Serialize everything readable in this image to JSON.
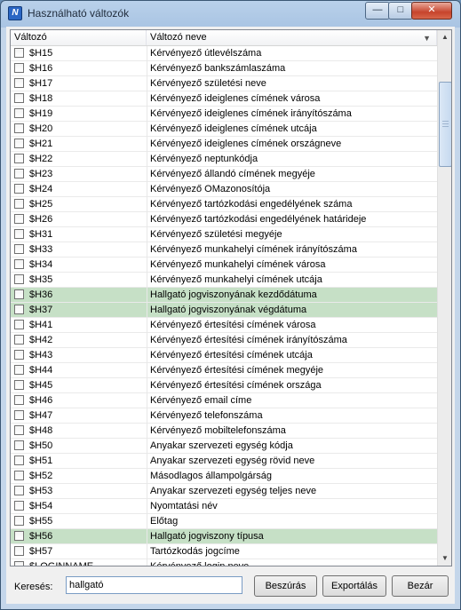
{
  "window": {
    "title": "Használható változók",
    "app_icon": "N"
  },
  "columns": {
    "variable": "Változó",
    "name": "Változó neve"
  },
  "rows": [
    {
      "var": "$H15",
      "name": "Kérvényező útlevélszáma",
      "highlight": false
    },
    {
      "var": "$H16",
      "name": "Kérvényező bankszámlaszáma",
      "highlight": false
    },
    {
      "var": "$H17",
      "name": "Kérvényező születési neve",
      "highlight": false
    },
    {
      "var": "$H18",
      "name": "Kérvényező ideiglenes címének városa",
      "highlight": false
    },
    {
      "var": "$H19",
      "name": "Kérvényező ideiglenes címének irányítószáma",
      "highlight": false
    },
    {
      "var": "$H20",
      "name": "Kérvényező ideiglenes címének utcája",
      "highlight": false
    },
    {
      "var": "$H21",
      "name": "Kérvényező ideiglenes címének országneve",
      "highlight": false
    },
    {
      "var": "$H22",
      "name": "Kérvényező neptunkódja",
      "highlight": false
    },
    {
      "var": "$H23",
      "name": "Kérvényező állandó címének megyéje",
      "highlight": false
    },
    {
      "var": "$H24",
      "name": "Kérvényező OMazonosítója",
      "highlight": false
    },
    {
      "var": "$H25",
      "name": "Kérvényező tartózkodási engedélyének száma",
      "highlight": false
    },
    {
      "var": "$H26",
      "name": "Kérvényező tartózkodási engedélyének határideje",
      "highlight": false
    },
    {
      "var": "$H31",
      "name": "Kérvényező születési megyéje",
      "highlight": false
    },
    {
      "var": "$H33",
      "name": "Kérvényező munkahelyi címének irányítószáma",
      "highlight": false
    },
    {
      "var": "$H34",
      "name": "Kérvényező munkahelyi címének városa",
      "highlight": false
    },
    {
      "var": "$H35",
      "name": "Kérvényező munkahelyi címének utcája",
      "highlight": false
    },
    {
      "var": "$H36",
      "name": "Hallgató jogviszonyának kezdődátuma",
      "highlight": true
    },
    {
      "var": "$H37",
      "name": "Hallgató jogviszonyának végdátuma",
      "highlight": true
    },
    {
      "var": "$H41",
      "name": "Kérvényező értesítési címének városa",
      "highlight": false
    },
    {
      "var": "$H42",
      "name": "Kérvényező értesítési címének irányítószáma",
      "highlight": false
    },
    {
      "var": "$H43",
      "name": "Kérvényező értesítési címének utcája",
      "highlight": false
    },
    {
      "var": "$H44",
      "name": "Kérvényező értesítési címének megyéje",
      "highlight": false
    },
    {
      "var": "$H45",
      "name": "Kérvényező értesítési címének országa",
      "highlight": false
    },
    {
      "var": "$H46",
      "name": "Kérvényező email címe",
      "highlight": false
    },
    {
      "var": "$H47",
      "name": "Kérvényező telefonszáma",
      "highlight": false
    },
    {
      "var": "$H48",
      "name": "Kérvényező mobiltelefonszáma",
      "highlight": false
    },
    {
      "var": "$H50",
      "name": "Anyakar szervezeti egység kódja",
      "highlight": false
    },
    {
      "var": "$H51",
      "name": "Anyakar szervezeti egység rövid neve",
      "highlight": false
    },
    {
      "var": "$H52",
      "name": "Másodlagos állampolgárság",
      "highlight": false
    },
    {
      "var": "$H53",
      "name": "Anyakar szervezeti egység teljes neve",
      "highlight": false
    },
    {
      "var": "$H54",
      "name": "Nyomtatási név",
      "highlight": false
    },
    {
      "var": "$H55",
      "name": "Előtag",
      "highlight": false
    },
    {
      "var": "$H56",
      "name": "Hallgató jogviszony típusa",
      "highlight": true
    },
    {
      "var": "$H57",
      "name": "Tartózkodás jogcíme",
      "highlight": false
    },
    {
      "var": "$LOGINNAME",
      "name": "Kérvényező login neve",
      "highlight": false
    }
  ],
  "footer": {
    "search_label": "Keresés:",
    "search_value": "hallgató",
    "search_button": "Beszúrás",
    "export_button": "Exportálás",
    "close_button": "Bezár"
  },
  "colors": {
    "highlight_row": "#c6e0c6",
    "title_bar": "#a9c4e3",
    "close_button": "#c7442c"
  },
  "icons": {
    "minimize": "minimize-icon",
    "maximize": "maximize-icon",
    "close": "close-icon",
    "scroll_up": "chevron-up-icon",
    "scroll_down": "chevron-down-icon",
    "sort": "sort-arrow-icon"
  }
}
